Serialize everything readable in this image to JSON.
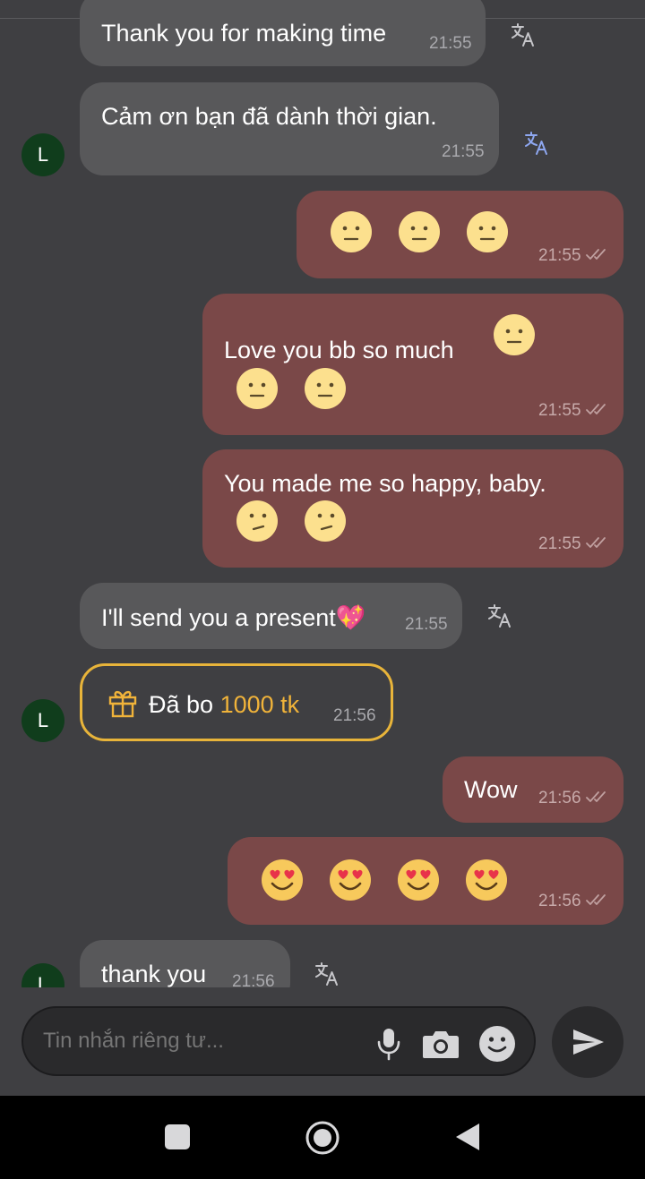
{
  "messages": [
    {
      "text": "Thank you for making time",
      "time": "21:55"
    },
    {
      "text": "Cảm ơn bạn đã dành thời gian.",
      "time": "21:55"
    },
    {
      "time": "21:55",
      "emojis": [
        "neutral-face",
        "neutral-face",
        "neutral-face"
      ]
    },
    {
      "text": "Love you bb so much",
      "time": "21:55",
      "emojis": [
        "neutral-face",
        "neutral-face",
        "neutral-face"
      ]
    },
    {
      "text": "You made me so happy, baby.",
      "time": "21:55",
      "emojis": [
        "face-with-rolling-eyes",
        "face-with-rolling-eyes"
      ]
    },
    {
      "text": "I'll send you a present💖",
      "time": "21:55"
    },
    {
      "time": "21:56",
      "emojis": [
        "smiling-face-with-heart-eyes",
        "smiling-face-with-heart-eyes",
        "smiling-face-with-heart-eyes",
        "smiling-face-with-heart-eyes"
      ]
    },
    {
      "text": "Wow",
      "time": "21:56"
    },
    {
      "text": "thank you",
      "time": "21:56"
    }
  ],
  "gift": {
    "prefix": "Đã bo ",
    "amount": "1000 tk",
    "time": "21:56"
  },
  "avatar": {
    "initial": "L"
  },
  "input": {
    "placeholder": "Tin nhắn riêng tư..."
  },
  "colors": {
    "incoming": "#58585a",
    "outgoing": "#7a4848",
    "gift_accent": "#f0b33a",
    "avatar": "#103d1c"
  },
  "icons": [
    "translate-icon",
    "gift-icon",
    "microphone-icon",
    "camera-icon",
    "emoji-icon",
    "send-icon",
    "double-check-icon",
    "nav-recents-icon",
    "nav-home-icon",
    "nav-back-icon"
  ]
}
